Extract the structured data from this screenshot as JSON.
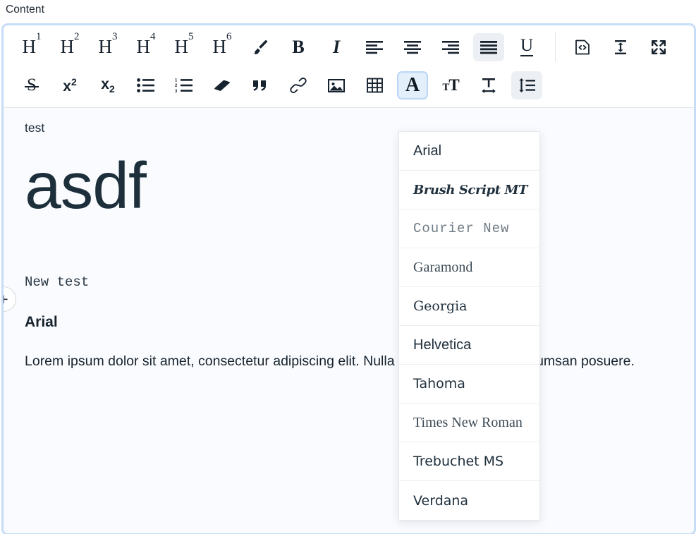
{
  "field": {
    "label": "Content"
  },
  "toolbar": {
    "row1": [
      {
        "name": "heading-1-button",
        "glyph": "H",
        "sup": "1",
        "type": "heading",
        "state": "default"
      },
      {
        "name": "heading-2-button",
        "glyph": "H",
        "sup": "2",
        "type": "heading",
        "state": "default"
      },
      {
        "name": "heading-3-button",
        "glyph": "H",
        "sup": "3",
        "type": "heading",
        "state": "default"
      },
      {
        "name": "heading-4-button",
        "glyph": "H",
        "sup": "4",
        "type": "heading",
        "state": "default"
      },
      {
        "name": "heading-5-button",
        "glyph": "H",
        "sup": "5",
        "type": "heading",
        "state": "default"
      },
      {
        "name": "heading-6-button",
        "glyph": "H",
        "sup": "6",
        "type": "heading",
        "state": "default"
      },
      {
        "name": "text-color-brush-icon",
        "type": "icon",
        "icon": "brush-icon",
        "state": "default"
      },
      {
        "name": "bold-button",
        "glyph": "B",
        "type": "bold",
        "state": "default"
      },
      {
        "name": "italic-button",
        "glyph": "I",
        "type": "italic",
        "state": "default"
      },
      {
        "name": "align-left-button",
        "type": "icon",
        "icon": "align-left-icon",
        "state": "default"
      },
      {
        "name": "align-center-button",
        "type": "icon",
        "icon": "align-center-icon",
        "state": "default"
      },
      {
        "name": "align-right-button",
        "type": "icon",
        "icon": "align-right-icon",
        "state": "default"
      },
      {
        "name": "align-justify-button",
        "type": "icon",
        "icon": "align-justify-icon",
        "state": "active-gray"
      },
      {
        "name": "underline-button",
        "glyph": "U",
        "type": "underline",
        "state": "default"
      },
      {
        "name": "toolbar-divider",
        "type": "separator",
        "state": "default"
      },
      {
        "name": "source-code-button",
        "type": "icon",
        "icon": "source-code-icon",
        "state": "default"
      },
      {
        "name": "line-height-vertical-button",
        "type": "icon",
        "icon": "vertical-arrow-icon",
        "state": "default"
      },
      {
        "name": "fullscreen-button",
        "type": "icon",
        "icon": "fullscreen-icon",
        "state": "default"
      }
    ],
    "row2": [
      {
        "name": "strikethrough-button",
        "glyph": "S",
        "type": "strike",
        "state": "default"
      },
      {
        "name": "superscript-button",
        "glyph": "x",
        "sup": "2",
        "type": "superscript",
        "state": "default"
      },
      {
        "name": "subscript-button",
        "glyph": "x",
        "sup": "2",
        "type": "subscript",
        "state": "default"
      },
      {
        "name": "bullet-list-button",
        "type": "icon",
        "icon": "bullet-list-icon",
        "state": "default"
      },
      {
        "name": "numbered-list-button",
        "type": "icon",
        "icon": "numbered-list-icon",
        "state": "default"
      },
      {
        "name": "clear-formatting-button",
        "type": "icon",
        "icon": "eraser-icon",
        "state": "default"
      },
      {
        "name": "blockquote-button",
        "type": "icon",
        "icon": "quote-icon",
        "state": "default"
      },
      {
        "name": "insert-link-button",
        "type": "icon",
        "icon": "link-icon",
        "state": "default"
      },
      {
        "name": "insert-image-button",
        "type": "icon",
        "icon": "image-icon",
        "state": "default"
      },
      {
        "name": "insert-table-button",
        "type": "icon",
        "icon": "table-icon",
        "state": "default"
      },
      {
        "name": "font-family-button",
        "glyph": "A",
        "type": "fontfamily",
        "state": "active-blue"
      },
      {
        "name": "font-size-button",
        "type": "fontsize",
        "state": "default"
      },
      {
        "name": "letter-spacing-button",
        "type": "icon",
        "icon": "letter-spacing-icon",
        "state": "default"
      },
      {
        "name": "line-spacing-button",
        "type": "icon",
        "icon": "line-spacing-icon",
        "state": "active-gray"
      }
    ]
  },
  "font_menu": {
    "open": true,
    "items": [
      {
        "label": "Arial",
        "class": "ff-arial"
      },
      {
        "label": "Brush Script MT",
        "class": "ff-brush"
      },
      {
        "label": "Courier New",
        "class": "ff-courier"
      },
      {
        "label": "Garamond",
        "class": "ff-garamond"
      },
      {
        "label": "Georgia",
        "class": "ff-georgia"
      },
      {
        "label": "Helvetica",
        "class": "ff-helv"
      },
      {
        "label": "Tahoma",
        "class": "ff-tahoma"
      },
      {
        "label": "Times New Roman",
        "class": "ff-times"
      },
      {
        "label": "Trebuchet MS",
        "class": "ff-trebuchet"
      },
      {
        "label": "Verdana",
        "class": "ff-verdana"
      }
    ]
  },
  "document": {
    "line_test": "test",
    "line_asdf": "asdf",
    "line_new_test": "New test",
    "line_arial": "Arial",
    "paragraph": "Lorem ipsum dolor sit amet, consectetur adipiscing elit. Nulla sollicitudin eget mi accumsan posuere."
  },
  "handles": {
    "add_block_label": "+"
  },
  "colors": {
    "focus_border": "#c6dcf7",
    "editor_background": "#f9fbff",
    "toolbar_background": "#ffffff",
    "active_blue_bg": "#e4effc",
    "active_gray_bg": "#eceff3",
    "text": "#1a2733"
  }
}
